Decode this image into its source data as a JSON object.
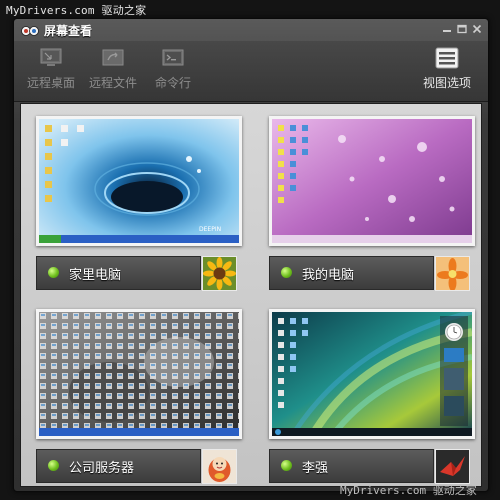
{
  "watermark": {
    "top": "MyDrivers.com 驱动之家",
    "bottom": "MyDrivers.com 驱动之家"
  },
  "window": {
    "title": "屏幕查看"
  },
  "toolbar": {
    "remote_desktop": "远程桌面",
    "remote_files": "远程文件",
    "command_line": "命令行",
    "view_options": "视图选项"
  },
  "computers": [
    {
      "name": "家里电脑",
      "status": "online",
      "wallpaper": "water-drop-blue",
      "avatar": "sunflower"
    },
    {
      "name": "我的电脑",
      "status": "online",
      "wallpaper": "purple-raindrops",
      "avatar": "orange-flower"
    },
    {
      "name": "公司服务器",
      "status": "online",
      "wallpaper": "gray-desktop-cluttered",
      "avatar": "doll"
    },
    {
      "name": "李强",
      "status": "online",
      "wallpaper": "vista-aurora",
      "avatar": "origami-crane"
    }
  ],
  "colors": {
    "status_online": "#6fbf1e",
    "panel_bg": "#cfcfcf",
    "toolbar_bg": "#3e3e3e"
  }
}
